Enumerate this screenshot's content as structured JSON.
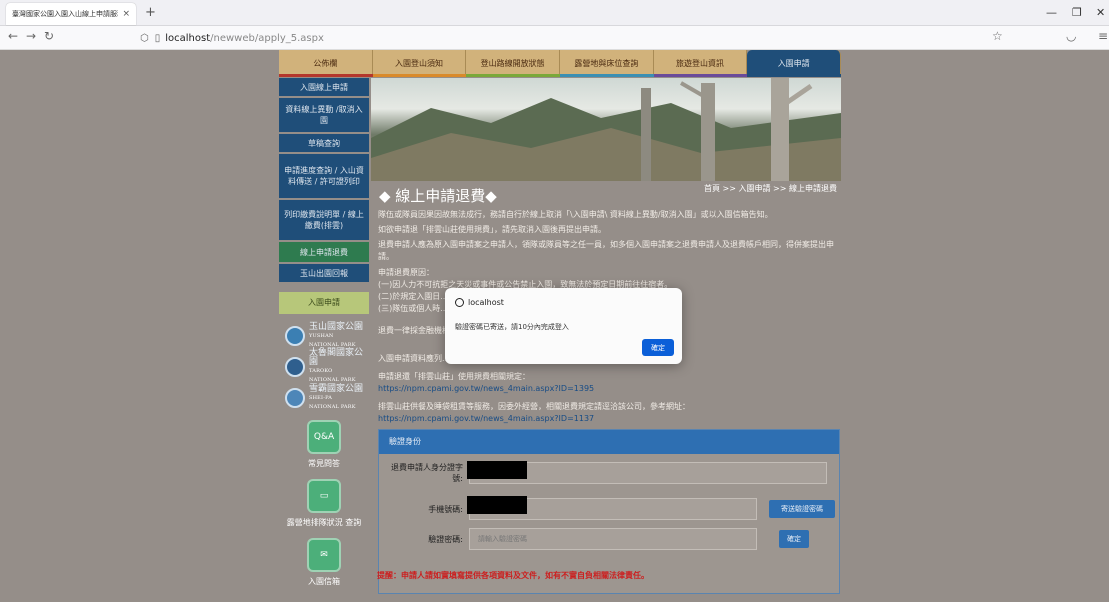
{
  "browser": {
    "tab_title": "臺灣國家公園入園入山線上申請服務",
    "tab_close": "×",
    "new_tab": "+",
    "url_host": "localhost",
    "url_path": "/newweb/apply_5.aspx"
  },
  "top_nav": [
    {
      "label": "公佈欄"
    },
    {
      "label": "入園登山須知"
    },
    {
      "label": "登山路線開放狀態"
    },
    {
      "label": "露營地與床位查詢"
    },
    {
      "label": "旅遊登山資訊"
    },
    {
      "label": "入園申請",
      "active": true
    }
  ],
  "sidebar": {
    "items": [
      {
        "label": "入園線上申請"
      },
      {
        "label": "資料線上異動 /取消入園"
      },
      {
        "label": "草稿查詢"
      },
      {
        "label": "申請進度查詢 / 入山資料傳送 / 許可證列印"
      },
      {
        "label": "列印繳費說明單 / 線上繳費(排雲)"
      },
      {
        "label": "線上申請退費",
        "active": true
      },
      {
        "label": "玉山出園回報"
      }
    ],
    "apply_button": "入園申請",
    "parks": [
      {
        "zh": "玉山國家公園",
        "en1": "YUSHAN",
        "en2": "NATIONAL PARK"
      },
      {
        "zh": "太魯閣國家公園",
        "en1": "TAROKO",
        "en2": "NATIONAL PARK"
      },
      {
        "zh": "雪霸國家公園",
        "en1": "SHEI-PA",
        "en2": "NATIONAL PARK"
      }
    ],
    "links": [
      {
        "icon": "Q&A",
        "label": "常見問答"
      },
      {
        "icon": "▭",
        "label": "露營地排隊狀況 查詢"
      },
      {
        "icon": "✉",
        "label": "入園信箱"
      }
    ]
  },
  "content": {
    "title": "◆ 線上申請退費◆",
    "breadcrumb": "首頁 >> 入園申請 >> 線上申請退費",
    "p1": "隊伍或隊員因果因故無法成行，務請自行於線上取消「\\入園申請\\ 資料線上異動/取消入園」或以入園信箱告知。",
    "p2": "如欲申請退「排雲山莊使用規費」，請先取消入園後再提出申請。",
    "p3": "退費申請人應為原入園申請案之申請人，領隊或隊員等之任一員，如多個入園申請案之退費申請人及退費帳戶相同，得併案提出申請。",
    "p4_head": "申請退費原因：",
    "p4_a": "(一)因人力不可抗拒之天災或事件或公告禁止入園，致無法於預定日期前往住宿者。",
    "p4_b": "(二)於規定入園日...",
    "p4_c": "(三)隊伍或個人時...",
    "p5": "退費一律採金融機構...（存摺）影本，否則請填寫（委託書）。（委託書...",
    "p6": "入園申請資料應列...請。",
    "p7_text": "申請退還「排雲山莊」使用規費相關規定：",
    "p7_link": "https://npm.cpami.gov.tw/news_4main.aspx?ID=1395",
    "p8_text": "排雲山莊供餐及睡袋租賃等服務，因委外經營，相關退費規定請逕洽該公司，參考網址：",
    "p8_link": "https://npm.cpami.gov.tw/news_4main.aspx?ID=1137"
  },
  "verify_form": {
    "header": "驗證身份",
    "id_label": "退費申請人身分證字號:",
    "phone_label": "手機號碼:",
    "code_label": "驗證密碼:",
    "code_placeholder": "請輸入驗證密碼",
    "send_button": "寄送驗證密碼",
    "confirm_button": "確定",
    "warning": "提醒：申請人請如實填寫提供各項資料及文件，如有不實自負相關法律責任。"
  },
  "dialog": {
    "host": "localhost",
    "message": "驗證密碼已寄送，請10分內完成登入",
    "ok": "確定"
  },
  "colors": {
    "nav_active": "#1f4e79",
    "nav_inactive": "#d1b27b",
    "page_bg": "#958e89",
    "primary_button": "#2e6fb2",
    "dialog_ok": "#0b5fd8",
    "warning_text": "#cc1f1f"
  }
}
